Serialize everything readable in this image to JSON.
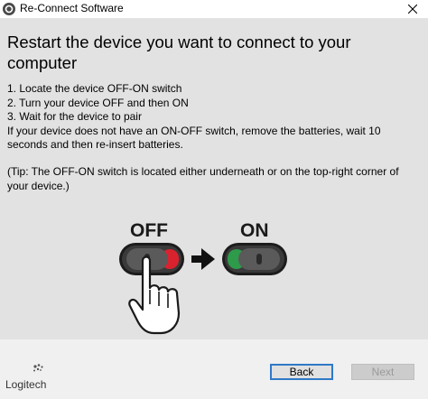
{
  "window": {
    "title": "Re-Connect Software"
  },
  "main": {
    "heading": "Restart the device you want to connect to your computer",
    "steps": [
      "1. Locate the device OFF-ON switch",
      "2. Turn your device OFF and then ON",
      "3. Wait for the device to pair"
    ],
    "battery_note_line1": "If your device does not have an ON-OFF switch, remove the batteries, wait 10",
    "battery_note_line2": "seconds and then re-insert batteries.",
    "tip_line1": "(Tip: The OFF-ON switch is located either underneath or on the top-right corner of",
    "tip_line2": "your device.)"
  },
  "illustration": {
    "off_label": "OFF",
    "on_label": "ON"
  },
  "footer": {
    "brand": "Logitech",
    "back_label": "Back",
    "next_label": "Next"
  },
  "colors": {
    "switch_off_accent": "#d8232f",
    "switch_on_accent": "#2e9b4a",
    "button_focus_border": "#2f79c8"
  }
}
